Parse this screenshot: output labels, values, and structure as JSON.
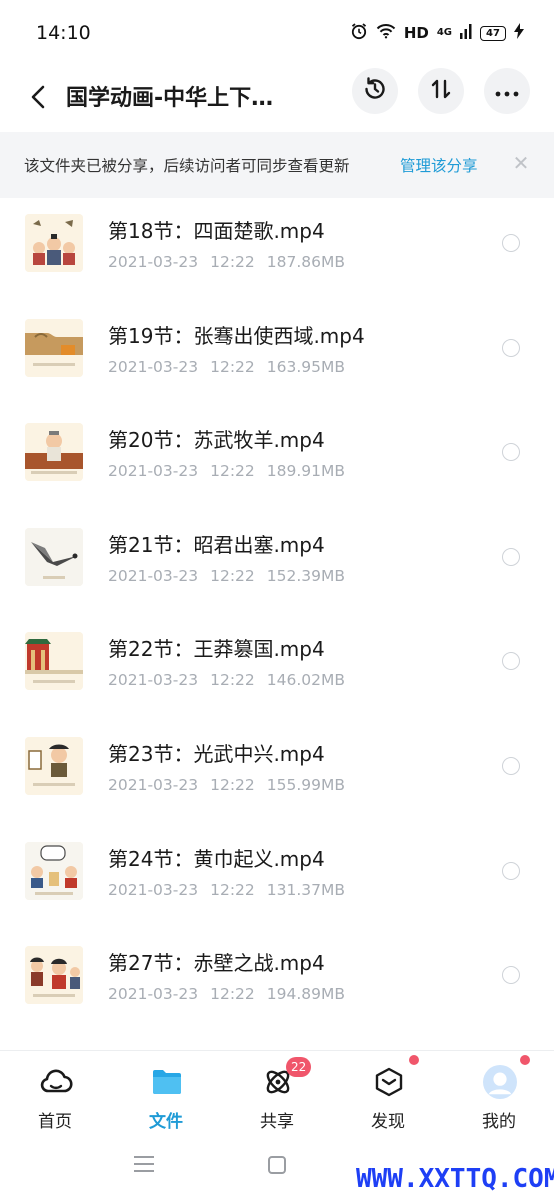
{
  "status_bar": {
    "time": "14:10",
    "hd_label": "HD",
    "network_label": "4G",
    "battery": "47"
  },
  "header": {
    "title": "国学动画-中华上下…",
    "icons": {
      "back": "chevron-left-icon",
      "history": "history-icon",
      "sort": "sort-icon",
      "more": "more-icon"
    }
  },
  "share_banner": {
    "message": "该文件夹已被分享，后续访问者可同步查看更新",
    "action": "管理该分享",
    "close": "✕"
  },
  "files": [
    {
      "name": "第18节：四面楚歌.mp4",
      "date": "2021-03-23",
      "time": "12:22",
      "size": "187.86MB"
    },
    {
      "name": "第19节：张骞出使西域.mp4",
      "date": "2021-03-23",
      "time": "12:22",
      "size": "163.95MB"
    },
    {
      "name": "第20节：苏武牧羊.mp4",
      "date": "2021-03-23",
      "time": "12:22",
      "size": "189.91MB"
    },
    {
      "name": "第21节：昭君出塞.mp4",
      "date": "2021-03-23",
      "time": "12:22",
      "size": "152.39MB"
    },
    {
      "name": "第22节：王莽篡国.mp4",
      "date": "2021-03-23",
      "time": "12:22",
      "size": "146.02MB"
    },
    {
      "name": "第23节：光武中兴.mp4",
      "date": "2021-03-23",
      "time": "12:22",
      "size": "155.99MB"
    },
    {
      "name": "第24节：黄巾起义.mp4",
      "date": "2021-03-23",
      "time": "12:22",
      "size": "131.37MB"
    },
    {
      "name": "第27节：赤壁之战.mp4",
      "date": "2021-03-23",
      "time": "12:22",
      "size": "194.89MB"
    }
  ],
  "bottom_nav": {
    "items": [
      {
        "label": "首页",
        "icon": "cloud-icon"
      },
      {
        "label": "文件",
        "icon": "folder-icon",
        "active": true
      },
      {
        "label": "共享",
        "icon": "atom-icon",
        "badge": "22"
      },
      {
        "label": "发现",
        "icon": "cube-icon",
        "dot": true
      },
      {
        "label": "我的",
        "icon": "avatar-icon",
        "dot": true
      }
    ]
  },
  "watermark": "WWW.XXTTQ.COM",
  "colors": {
    "accent": "#1f9bd6",
    "badge": "#f0566b",
    "muted_text": "#a8adb4",
    "banner_bg": "#f4f5f7"
  }
}
